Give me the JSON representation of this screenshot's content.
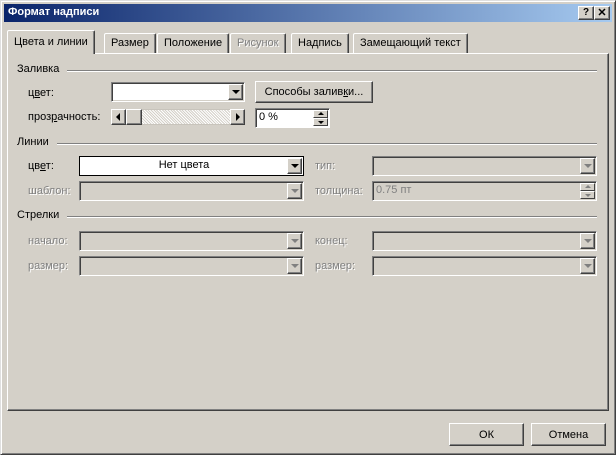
{
  "window": {
    "title": "Формат надписи",
    "help_glyph": "?",
    "close_glyph": "✕"
  },
  "tabs": [
    {
      "label": "Цвета и линии",
      "active": true,
      "enabled": true
    },
    {
      "label": "Размер",
      "active": false,
      "enabled": true
    },
    {
      "label": "Положение",
      "active": false,
      "enabled": true
    },
    {
      "label": "Рисунок",
      "active": false,
      "enabled": false
    },
    {
      "label": "Надпись",
      "active": false,
      "enabled": true
    },
    {
      "label": "Замещающий текст",
      "active": false,
      "enabled": true
    }
  ],
  "fill": {
    "group_title": "Заливка",
    "color_label_a": "ц",
    "color_label_u": "в",
    "color_label_b": "ет:",
    "color_value": "",
    "fill_effects_button_a": "Способы залив",
    "fill_effects_button_u": "к",
    "fill_effects_button_b": "и...",
    "transparency_label_a": "проз",
    "transparency_label_u": "р",
    "transparency_label_b": "ачность:",
    "transparency_value": "0 %",
    "transparency_fraction": 0
  },
  "lines": {
    "group_title": "Линии",
    "color_label_a": "цв",
    "color_label_u": "е",
    "color_label_b": "т:",
    "color_value": "Нет цвета",
    "type_label": "тип:",
    "type_value": "",
    "pattern_label": "шаблон:",
    "pattern_value": "",
    "weight_label": "толщина:",
    "weight_value": "0.75 пт"
  },
  "arrows": {
    "group_title": "Стрелки",
    "begin_label": "начало:",
    "begin_value": "",
    "end_label": "конец:",
    "end_value": "",
    "begin_size_label": "размер:",
    "begin_size_value": "",
    "end_size_label": "размер:",
    "end_size_value": ""
  },
  "footer": {
    "ok_label": "ОК",
    "cancel_label": "Отмена"
  }
}
